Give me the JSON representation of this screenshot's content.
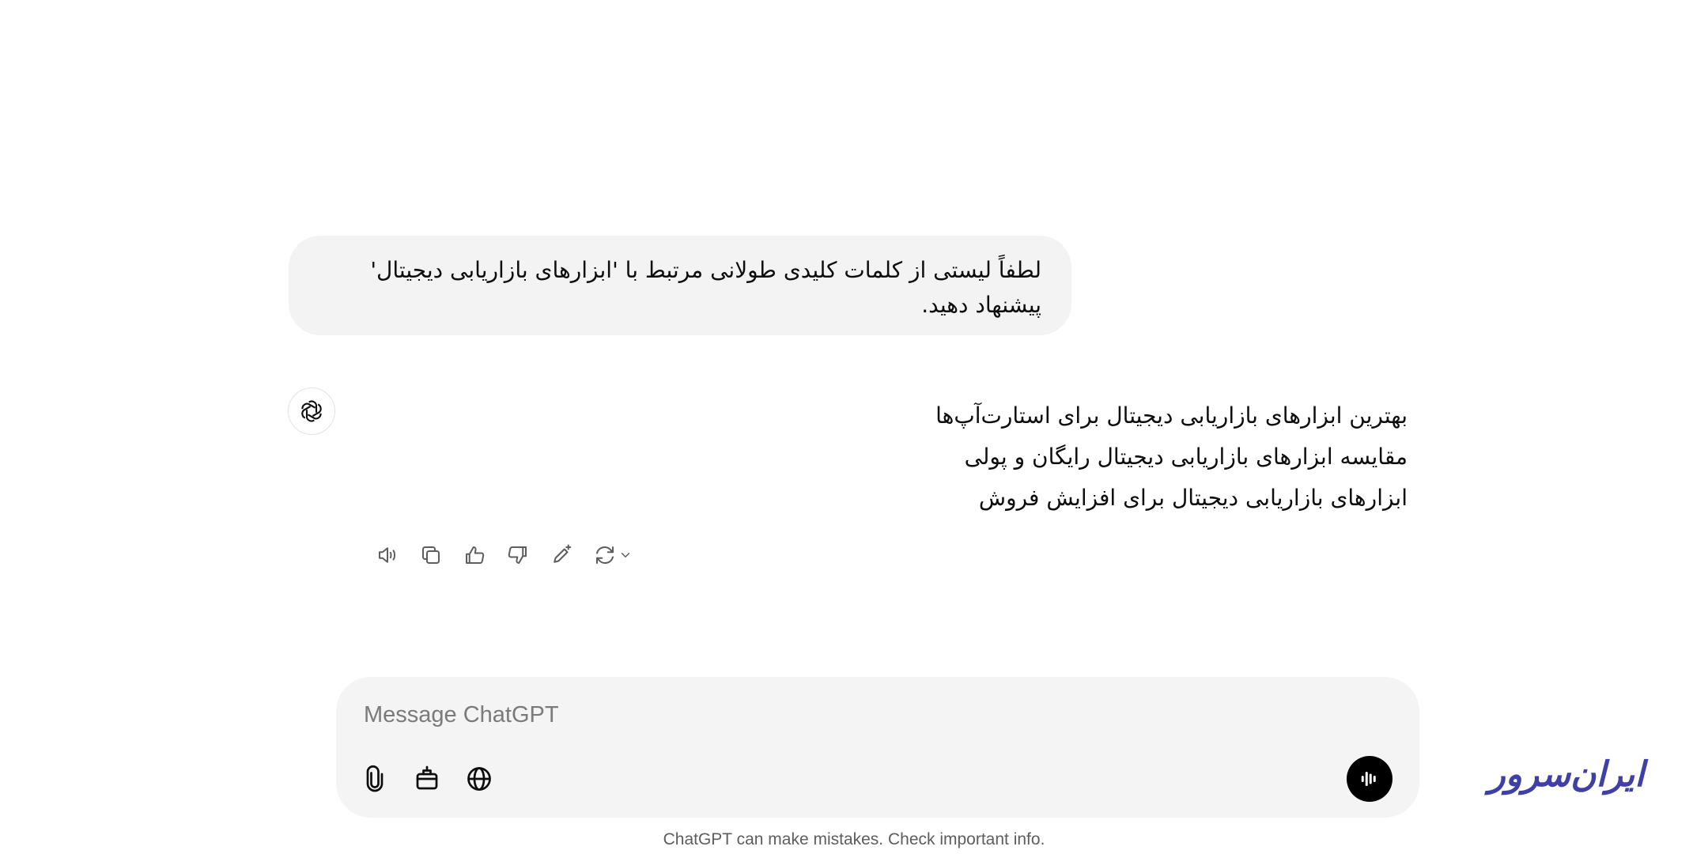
{
  "conversation": {
    "user_message": "لطفاً لیستی از کلمات کلیدی طولانی مرتبط با 'ابزارهای بازاریابی دیجیتال' پیشنهاد دهید.",
    "assistant_avatar_icon": "openai-logo-icon",
    "assistant_lines": [
      "بهترین ابزارهای بازاریابی دیجیتال برای استارت‌آپ‌ها",
      "مقایسه ابزارهای بازاریابی دیجیتال رایگان و پولی",
      "ابزارهای بازاریابی دیجیتال برای افزایش فروش"
    ],
    "actions": [
      {
        "name": "read-aloud",
        "icon": "speaker-icon"
      },
      {
        "name": "copy",
        "icon": "copy-icon"
      },
      {
        "name": "good-response",
        "icon": "thumbs-up-icon"
      },
      {
        "name": "bad-response",
        "icon": "thumbs-down-icon"
      },
      {
        "name": "edit-in-canvas",
        "icon": "pencil-sparkle-icon"
      },
      {
        "name": "regenerate",
        "icon": "refresh-icon"
      }
    ]
  },
  "composer": {
    "placeholder": "Message ChatGPT",
    "value": "",
    "tools": [
      {
        "name": "attach",
        "icon": "paperclip-icon"
      },
      {
        "name": "tools",
        "icon": "toolbox-icon"
      },
      {
        "name": "search",
        "icon": "globe-icon"
      }
    ],
    "voice_icon": "voice-mode-icon"
  },
  "watermark": {
    "text": "ایران‌سرور",
    "color": "#3f3fa8"
  },
  "disclaimer": "ChatGPT can make mistakes. Check important info.",
  "colors": {
    "bubble": "#f3f3f3",
    "composer": "#f4f4f4",
    "voice_button": "#000000"
  }
}
